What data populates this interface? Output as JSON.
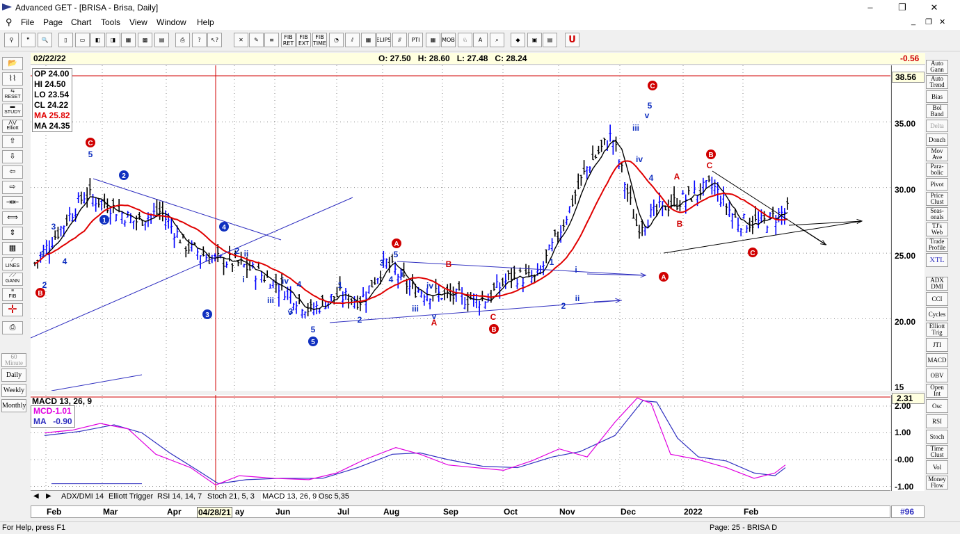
{
  "window": {
    "title": "Advanced GET - [BRISA - Brisa, Daily]",
    "minimize": "–",
    "restore": "❐",
    "close": "✕"
  },
  "menu": [
    "File",
    "Page",
    "Chart",
    "Tools",
    "View",
    "Window",
    "Help"
  ],
  "mdi": {
    "minimize": "_",
    "restore": "❐",
    "close": "✕"
  },
  "toolbar": {
    "b9": "FIB RET",
    "b10": "FIB EXT",
    "b11": "FIB TIME",
    "b14": "ELIPS",
    "b16": "PTI",
    "b18": "MOB"
  },
  "left_toolbar": {
    "reset": "RESET",
    "study": "STUDY",
    "elliott": "Elliott",
    "lines": "LINES",
    "gann": "GANN",
    "fib": "FIB"
  },
  "timeframes": [
    "60 Minute",
    "Daily",
    "Weekly",
    "Monthly"
  ],
  "right_tools": [
    "Auto Gann",
    "Auto Trend",
    "Bias",
    "Bol Band",
    "Delta",
    "Donch",
    "Mov Ave",
    "Para-bolic",
    "Pivot",
    "Price Clust",
    "Seas-onals",
    "TJ's Web",
    "Trade Profile",
    "XTL",
    "ADX DMI",
    "CCI",
    "Cycles",
    "Elliott Trig",
    "JTI",
    "MACD",
    "OBV",
    "Open Int",
    "Osc",
    "RSI",
    "Stoch",
    "Time Clust",
    "Vol",
    "Money Flow"
  ],
  "header": {
    "date": "02/22/22",
    "ohlc": "O: 27.50   H: 28.60   L: 27.48   C: 28.24",
    "change": "-0.56"
  },
  "cursor_values": {
    "op": "OP 24.00",
    "hi": "HI  24.50",
    "lo": "LO 23.54",
    "cl": "CL  24.22",
    "ma1": "MA 25.82",
    "ma2": "MA 24.35"
  },
  "price_scale": {
    "top_label": "38.56",
    "ticks": [
      "35.00",
      "30.00",
      "25.00",
      "20.00",
      "15"
    ]
  },
  "macd": {
    "title": "MACD 13, 26, 9",
    "mcd": "MCD-1.01",
    "ma": "MA   -0.90",
    "top_label": "2.31",
    "ticks": [
      "2.00",
      "1.00",
      "-0.00",
      "-1.00"
    ]
  },
  "tabs": [
    "ADX/DMI 14",
    "Elliott Trigger",
    "RSI 14, 14, 7",
    "Stoch 21, 5, 3",
    "MACD 13, 26, 9",
    "Osc 5,35"
  ],
  "months": [
    "Feb",
    "Mar",
    "Apr",
    "04/28/21",
    "ay",
    "Jun",
    "Jul",
    "Aug",
    "Sep",
    "Oct",
    "Nov",
    "Dec",
    "2022",
    "Feb"
  ],
  "page_number": "#96",
  "status": {
    "help": "For Help, press F1",
    "page": "Page: 25 - BRISA D"
  },
  "elliott_labels": {
    "red": [
      "C",
      "B",
      "A",
      "B",
      "C",
      "A",
      "B",
      "C",
      "B",
      "A",
      "C"
    ],
    "blue_circle": [
      "2",
      "1",
      "4",
      "3",
      "5"
    ],
    "small": [
      "5",
      "1",
      "2",
      "3",
      "4",
      "1",
      "2",
      "2",
      "ii",
      "i",
      "iii",
      "iv",
      "v",
      "4",
      "3",
      "5",
      "1",
      "2",
      "3",
      "5",
      "i",
      "4",
      "iii",
      "iv",
      "v",
      "1",
      "2",
      "ii",
      "iii",
      "iv",
      "5",
      "5",
      "v",
      "3",
      "iv",
      "4",
      "i",
      "B",
      "A",
      "C",
      "A",
      "B",
      "C",
      "A",
      "B",
      "C"
    ]
  },
  "chart_data": {
    "type": "candlestick",
    "symbol": "BRISA",
    "interval": "Daily",
    "y_range": [
      15,
      38.56
    ],
    "ohlc_weekly": [
      {
        "month": "Feb",
        "close": 24.2
      },
      {
        "month": "Feb",
        "close": 26.8
      },
      {
        "month": "Mar",
        "close": 29.5
      },
      {
        "month": "Mar",
        "close": 28.6
      },
      {
        "month": "Mar",
        "close": 27.4
      },
      {
        "month": "Apr",
        "close": 28.2
      },
      {
        "month": "Apr",
        "close": 25.6
      },
      {
        "month": "Apr",
        "close": 24.6
      },
      {
        "month": "May",
        "close": 24.3
      },
      {
        "month": "May",
        "close": 23.4
      },
      {
        "month": "Jun",
        "close": 22.2
      },
      {
        "month": "Jun",
        "close": 20.6
      },
      {
        "month": "Jul",
        "close": 21.8
      },
      {
        "month": "Jul",
        "close": 21.4
      },
      {
        "month": "Aug",
        "close": 24.3
      },
      {
        "month": "Aug",
        "close": 22.3
      },
      {
        "month": "Sep",
        "close": 21.9
      },
      {
        "month": "Sep",
        "close": 21.6
      },
      {
        "month": "Oct",
        "close": 21.5
      },
      {
        "month": "Oct",
        "close": 23.3
      },
      {
        "month": "Nov",
        "close": 23.0
      },
      {
        "month": "Nov",
        "close": 27.0
      },
      {
        "month": "Nov",
        "close": 31.5
      },
      {
        "month": "Dec",
        "close": 34.0
      },
      {
        "month": "Dec",
        "close": 27.0
      },
      {
        "month": "Dec",
        "close": 28.5
      },
      {
        "month": "2022",
        "close": 29.2
      },
      {
        "month": "2022",
        "close": 30.2
      },
      {
        "month": "2022",
        "close": 27.4
      },
      {
        "month": "Feb",
        "close": 27.3
      },
      {
        "month": "Feb",
        "close": 28.24
      }
    ]
  },
  "colors": {
    "up": "#0000ff",
    "down": "#000000",
    "ma_fast": "#000000",
    "ma_slow": "#e00000",
    "macd_line": "#e000e0",
    "macd_signal": "#3030c0",
    "cursor": "#d00000"
  }
}
